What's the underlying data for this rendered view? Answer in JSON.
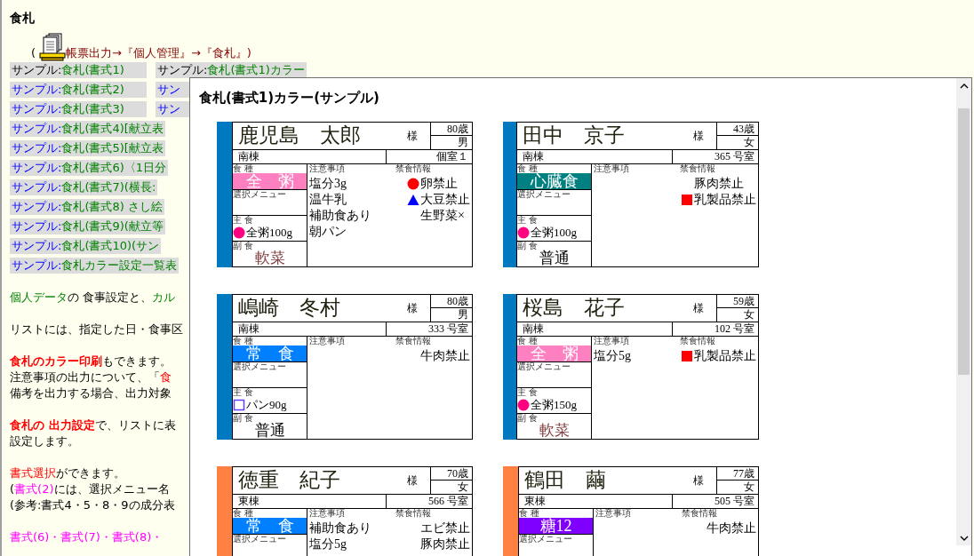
{
  "page": {
    "heading": "食札",
    "path_open": "(",
    "path": "帳票出力→『個人管理』→『食札』)"
  },
  "sample_rows": [
    {
      "items": [
        {
          "prefix": "サンプル:",
          "title": "食札(書式1)",
          "visited": true
        },
        {
          "prefix": "サンプル:",
          "title": "食札(書式1)カラー",
          "visited": true
        }
      ]
    },
    {
      "items": [
        {
          "prefix": "サンプル:",
          "title": "食札(書式2)",
          "visited": false
        },
        {
          "prefix": "サン",
          "visited": false
        }
      ]
    },
    {
      "items": [
        {
          "prefix": "サンプル:",
          "title": "食札(書式3)",
          "visited": false
        },
        {
          "prefix": "サン",
          "visited": false
        }
      ]
    },
    {
      "items": [
        {
          "prefix": "サンプル:",
          "title": "食札(書式4)[献立表",
          "visited": false
        }
      ]
    },
    {
      "items": [
        {
          "prefix": "サンプル:",
          "title": "食札(書式5)[献立表",
          "visited": false
        }
      ]
    },
    {
      "items": [
        {
          "prefix": "サンプル:",
          "title": "食札(書式6)〈1日分",
          "visited": false
        }
      ]
    },
    {
      "items": [
        {
          "prefix": "サンプル:",
          "title": "食札(書式7)(横長:",
          "visited": false
        }
      ]
    },
    {
      "items": [
        {
          "prefix": "サンプル:",
          "title": "食札(書式8) さし絵",
          "visited": false
        }
      ]
    },
    {
      "items": [
        {
          "prefix": "サンプル:",
          "title": "食札(書式9)(献立等",
          "visited": false
        }
      ]
    },
    {
      "items": [
        {
          "prefix": "サンプル:",
          "title": "食札(書式10)(サン",
          "visited": false
        }
      ]
    },
    {
      "items": [
        {
          "prefix": "サンプル:",
          "title": "食札カラー設定一覧表",
          "visited": false
        }
      ]
    }
  ],
  "paragraphs": [
    {
      "lines": [
        [
          {
            "kind": "link",
            "text": "個人データ"
          },
          {
            "kind": "plain",
            "text": "の 食事設定と、"
          },
          {
            "kind": "link",
            "text": "カル"
          }
        ]
      ]
    },
    {
      "lines": [
        [
          {
            "kind": "plain",
            "text": "リストには、指定した日・食事区"
          }
        ]
      ]
    },
    {
      "lines": [
        [
          {
            "kind": "strong",
            "text": "食札のカラー印刷"
          },
          {
            "kind": "plain",
            "text": "もできます。"
          }
        ],
        [
          {
            "kind": "plain",
            "text": "注意事項の出力について、「"
          },
          {
            "kind": "term",
            "text": "食"
          }
        ],
        [
          {
            "kind": "plain",
            "text": "備考を出力する場合、出力対象"
          }
        ]
      ]
    },
    {
      "lines": [
        [
          {
            "kind": "strong",
            "text": "食札の 出力設定"
          },
          {
            "kind": "plain",
            "text": "で、リストに表"
          }
        ],
        [
          {
            "kind": "plain",
            "text": "設定します。"
          }
        ]
      ]
    },
    {
      "lines": [
        [
          {
            "kind": "term",
            "text": "書式選択"
          },
          {
            "kind": "plain",
            "text": "ができます。"
          }
        ],
        [
          {
            "kind": "plain",
            "text": "("
          },
          {
            "kind": "ref",
            "text": "書式(2)"
          },
          {
            "kind": "plain",
            "text": "には、選択メニュー名"
          }
        ],
        [
          {
            "kind": "plain",
            "text": "(参考:書式4・5・8・9の成分表"
          }
        ]
      ]
    },
    {
      "lines": [
        [
          {
            "kind": "ref",
            "text": "書式(6)・書式(7)・書式(8)・"
          }
        ]
      ]
    }
  ],
  "popup": {
    "title": "食札(書式1)カラー(サンプル)",
    "cards": [
      {
        "name": "鹿児島　太郎",
        "honorific": "様",
        "age": "80歳",
        "sex": "男",
        "ward": "南棟",
        "room": "個室１",
        "color": "#0079c1",
        "diet_label": "食 種",
        "diet": {
          "text": "全　粥",
          "color": "#ff80c0"
        },
        "menu_label": "選択メニュー",
        "staple_label": "主 食",
        "staple": {
          "text": "全粥100g",
          "marker": {
            "kind": "circle",
            "color": "#ff0080"
          }
        },
        "side_label": "副 食",
        "side": {
          "text": "軟菜",
          "color": "#804040"
        },
        "notes_label": "注意事項",
        "notes": [
          "塩分3g",
          "温牛乳",
          "補助食あり",
          "朝パン"
        ],
        "allergy_label": "禁食情報",
        "allergies": [
          {
            "text": "卵禁止",
            "marker": {
              "kind": "circle",
              "color": "#ff0000"
            }
          },
          {
            "text": "大豆禁止",
            "marker": {
              "kind": "triangle",
              "color": "#0000ff"
            }
          },
          {
            "text": "生野菜×"
          }
        ]
      },
      {
        "name": "田中　京子",
        "honorific": "様",
        "age": "43歳",
        "sex": "女",
        "ward": "南棟",
        "room": "365 号室",
        "color": "#0079c1",
        "diet_label": "食 種",
        "diet": {
          "text": "心臓食",
          "color": "#008080"
        },
        "menu_label": "選択メニュー",
        "staple_label": "主 食",
        "staple": {
          "text": "全粥100g",
          "marker": {
            "kind": "circle",
            "color": "#ff0080"
          }
        },
        "side_label": "副 食",
        "side": {
          "text": "普通",
          "color": "#000000"
        },
        "notes_label": "注意事項",
        "allergy_label": "禁食情報",
        "allergies": [
          {
            "text": "豚肉禁止"
          },
          {
            "text": "乳製品禁止",
            "marker": {
              "kind": "square",
              "color": "#ff0000"
            }
          }
        ]
      },
      {
        "name": "嶋崎　冬村",
        "honorific": "様",
        "age": "80歳",
        "sex": "男",
        "ward": "南棟",
        "room": "333 号室",
        "color": "#0079c1",
        "diet_label": "食 種",
        "diet": {
          "text": "常　食",
          "color": "#0080ff"
        },
        "menu_label": "選択メニュー",
        "staple_label": "主 食",
        "staple": {
          "text": "パン90g",
          "marker": {
            "kind": "square_outline",
            "color": "#6040ff"
          }
        },
        "side_label": "副 食",
        "side": {
          "text": "普通",
          "color": "#000000"
        },
        "notes_label": "注意事項",
        "allergy_label": "禁食情報",
        "allergies": [
          {
            "text": "牛肉禁止"
          }
        ]
      },
      {
        "name": "桜島　花子",
        "honorific": "様",
        "age": "59歳",
        "sex": "女",
        "ward": "南棟",
        "room": "102 号室",
        "color": "#0079c1",
        "diet_label": "食 種",
        "diet": {
          "text": "全　粥",
          "color": "#ff80c0"
        },
        "menu_label": "選択メニュー",
        "staple_label": "主 食",
        "staple": {
          "text": "全粥150g",
          "marker": {
            "kind": "circle",
            "color": "#ff0080"
          }
        },
        "side_label": "副 食",
        "side": {
          "text": "軟菜",
          "color": "#804040"
        },
        "notes_label": "注意事項",
        "notes": [
          "塩分5g"
        ],
        "allergy_label": "禁食情報",
        "allergies": [
          {
            "text": "乳製品禁止",
            "marker": {
              "kind": "square",
              "color": "#ff0000"
            }
          }
        ]
      },
      {
        "name": "徳重　紀子",
        "honorific": "様",
        "age": "70歳",
        "sex": "女",
        "ward": "東棟",
        "room": "566 号室",
        "color": "#ff8040",
        "diet_label": "食 種",
        "diet": {
          "text": "常　食",
          "color": "#0080ff"
        },
        "menu_label": "選択メニュー",
        "notes_label": "注意事項",
        "notes": [
          "補助食あり",
          "塩分5g"
        ],
        "allergy_label": "禁食情報",
        "allergies": [
          {
            "text": "エビ禁止"
          },
          {
            "text": "豚肉禁止"
          }
        ]
      },
      {
        "name": "鶴田　繭",
        "honorific": "様",
        "age": "77歳",
        "sex": "女",
        "ward": "東棟",
        "room": "505 号室",
        "color": "#ff8040",
        "diet_label": "食 種",
        "diet": {
          "text": "糖12",
          "color": "#8000ff"
        },
        "menu_label": "選択メニュー",
        "notes_label": "注意事項",
        "allergy_label": "禁食情報",
        "allergies": [
          {
            "text": "牛肉禁止"
          }
        ]
      }
    ]
  }
}
